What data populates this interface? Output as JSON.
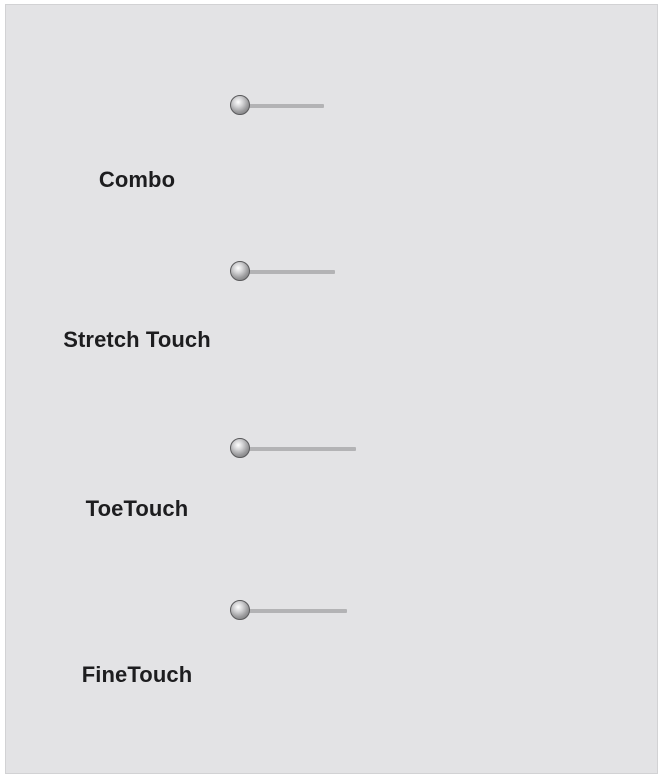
{
  "items": [
    {
      "label": "Combo",
      "level": 0.28
    },
    {
      "label": "Stretch Touch",
      "level": 0.32
    },
    {
      "label": "ToeTouch",
      "level": 0.39
    },
    {
      "label": "FineTouch",
      "level": 0.36
    }
  ],
  "colors": {
    "background": "#e3e3e5",
    "track": "#b3b3b5",
    "knob": "#9a9a9c",
    "text": "#1d1d1f"
  }
}
